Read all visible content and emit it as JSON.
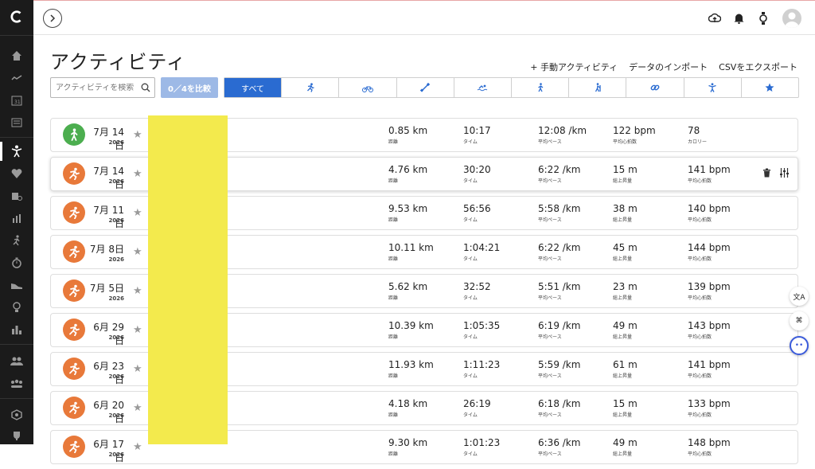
{
  "page": {
    "title": "アクティビティ",
    "actions": [
      "+ 手動アクティビティ",
      "データのインポート",
      "CSVをエクスポート"
    ]
  },
  "search": {
    "placeholder": "アクティビティを検索"
  },
  "compare_label": "0／4を比較",
  "filters": [
    {
      "label": "すべて",
      "icon": "all",
      "active": true
    },
    {
      "label": "",
      "icon": "running-icon"
    },
    {
      "label": "",
      "icon": "cycling-icon"
    },
    {
      "label": "",
      "icon": "fitness-icon"
    },
    {
      "label": "",
      "icon": "swimming-icon"
    },
    {
      "label": "",
      "icon": "walking-icon"
    },
    {
      "label": "",
      "icon": "hiking-icon"
    },
    {
      "label": "",
      "icon": "multisport-icon"
    },
    {
      "label": "",
      "icon": "other-icon"
    },
    {
      "label": "",
      "icon": "favorites-star-icon"
    }
  ],
  "colors": {
    "accent": "#2a6bd1",
    "run": "#e8793a",
    "walk": "#4cae4f",
    "highlight": "#f3ea4d"
  },
  "activities": [
    {
      "type": "walk",
      "date": "7月 14日",
      "year": "2026",
      "m": [
        [
          "0.85 km",
          "距離"
        ],
        [
          "10:17",
          "タイム"
        ],
        [
          "12:08 /km",
          "平均ペース"
        ],
        [
          "122 bpm",
          "平均心拍数"
        ],
        [
          "78",
          "カロリー"
        ]
      ]
    },
    {
      "type": "run",
      "date": "7月 14日",
      "year": "2026",
      "hover": true,
      "m": [
        [
          "4.76 km",
          "距離"
        ],
        [
          "30:20",
          "タイム"
        ],
        [
          "6:22 /km",
          "平均ペース"
        ],
        [
          "15 m",
          "総上昇量"
        ],
        [
          "141 bpm",
          "平均心拍数"
        ]
      ]
    },
    {
      "type": "run",
      "date": "7月 11日",
      "year": "2026",
      "m": [
        [
          "9.53 km",
          "距離"
        ],
        [
          "56:56",
          "タイム"
        ],
        [
          "5:58 /km",
          "平均ペース"
        ],
        [
          "38 m",
          "総上昇量"
        ],
        [
          "140 bpm",
          "平均心拍数"
        ]
      ]
    },
    {
      "type": "run",
      "date": "7月 8日",
      "year": "2026",
      "m": [
        [
          "10.11 km",
          "距離"
        ],
        [
          "1:04:21",
          "タイム"
        ],
        [
          "6:22 /km",
          "平均ペース"
        ],
        [
          "45 m",
          "総上昇量"
        ],
        [
          "144 bpm",
          "平均心拍数"
        ]
      ]
    },
    {
      "type": "run",
      "date": "7月 5日",
      "year": "2026",
      "m": [
        [
          "5.62 km",
          "距離"
        ],
        [
          "32:52",
          "タイム"
        ],
        [
          "5:51 /km",
          "平均ペース"
        ],
        [
          "23 m",
          "総上昇量"
        ],
        [
          "139 bpm",
          "平均心拍数"
        ]
      ]
    },
    {
      "type": "run",
      "date": "6月 29日",
      "year": "2026",
      "m": [
        [
          "10.39 km",
          "距離"
        ],
        [
          "1:05:35",
          "タイム"
        ],
        [
          "6:19 /km",
          "平均ペース"
        ],
        [
          "49 m",
          "総上昇量"
        ],
        [
          "143 bpm",
          "平均心拍数"
        ]
      ]
    },
    {
      "type": "run",
      "date": "6月 23日",
      "year": "2026",
      "m": [
        [
          "11.93 km",
          "距離"
        ],
        [
          "1:11:23",
          "タイム"
        ],
        [
          "5:59 /km",
          "平均ペース"
        ],
        [
          "61 m",
          "総上昇量"
        ],
        [
          "141 bpm",
          "平均心拍数"
        ]
      ]
    },
    {
      "type": "run",
      "date": "6月 20日",
      "year": "2026",
      "m": [
        [
          "4.18 km",
          "距離"
        ],
        [
          "26:19",
          "タイム"
        ],
        [
          "6:18 /km",
          "平均ペース"
        ],
        [
          "15 m",
          "総上昇量"
        ],
        [
          "133 bpm",
          "平均心拍数"
        ]
      ]
    },
    {
      "type": "run",
      "date": "6月 17日",
      "year": "2026",
      "m": [
        [
          "9.30 km",
          "距離"
        ],
        [
          "1:01:23",
          "タイム"
        ],
        [
          "6:36 /km",
          "平均ペース"
        ],
        [
          "49 m",
          "総上昇量"
        ],
        [
          "148 bpm",
          "平均心拍数"
        ]
      ]
    }
  ],
  "float_tools": [
    "文A",
    "⌘",
    "••"
  ]
}
